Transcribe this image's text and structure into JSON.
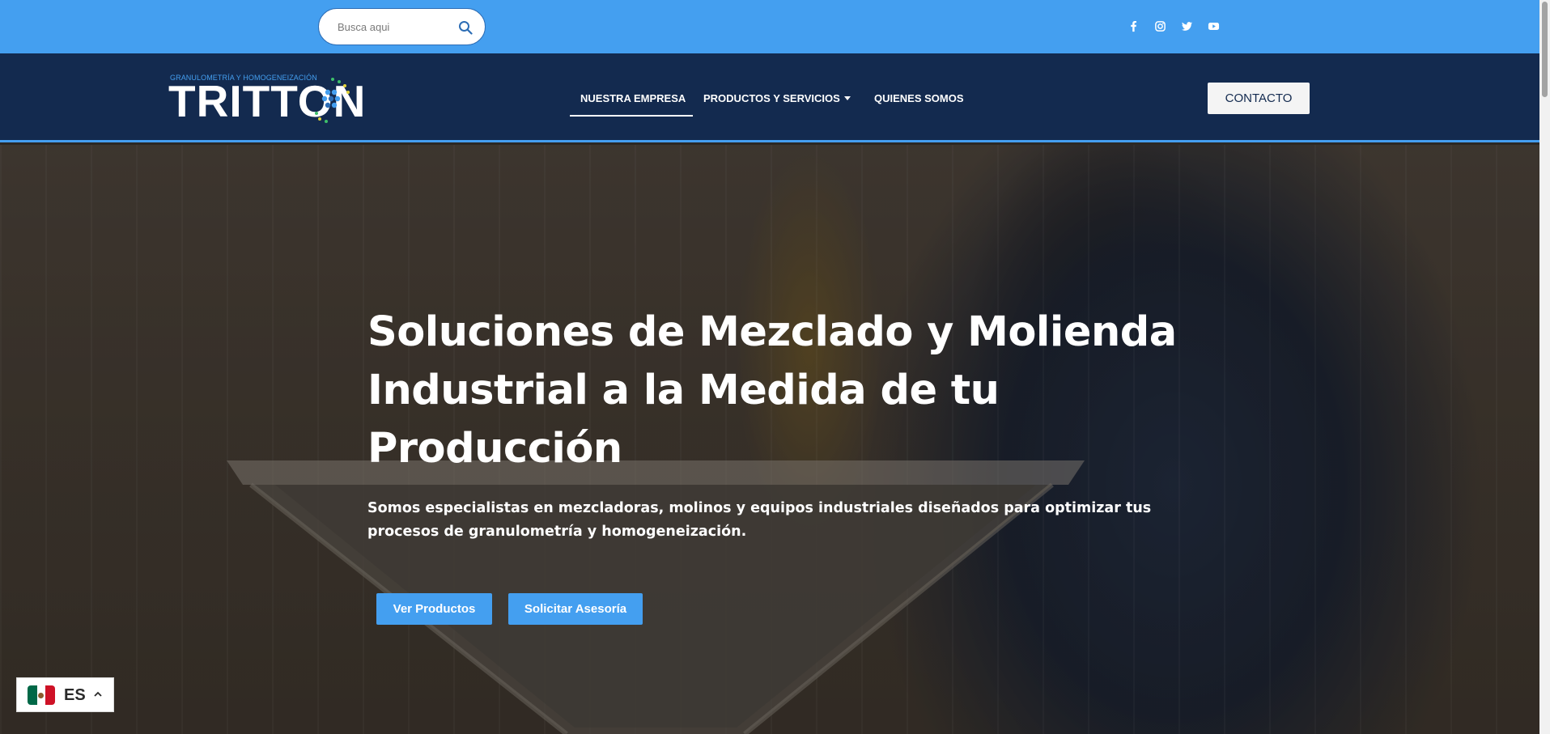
{
  "topbar": {
    "search_placeholder": "Busca aqui",
    "social": [
      "facebook-icon",
      "instagram-icon",
      "twitter-icon",
      "youtube-icon"
    ]
  },
  "header": {
    "logo_tagline": "GRANULOMETRÍA Y HOMOGENEIZACIÓN",
    "logo_text": "TRITTON",
    "nav": [
      {
        "label": "NUESTRA EMPRESA",
        "active": true
      },
      {
        "label": "PRODUCTOS Y SERVICIOS",
        "dropdown": true
      },
      {
        "label": "QUIENES SOMOS"
      }
    ],
    "contact_label": "CONTACTO"
  },
  "hero": {
    "title": "Soluciones de Mezclado y Molienda Industrial a la Medida de tu Producción",
    "subtitle": "Somos especialistas en mezcladoras, molinos y equipos industriales diseñados para optimizar tus procesos de granulometría y homogeneización.",
    "buttons": [
      "Ver Productos",
      "Solicitar Asesoría"
    ]
  },
  "language": {
    "code": "ES",
    "flag": "mexico-flag-icon"
  },
  "colors": {
    "accent": "#449ff0",
    "navy": "#132a4f"
  }
}
